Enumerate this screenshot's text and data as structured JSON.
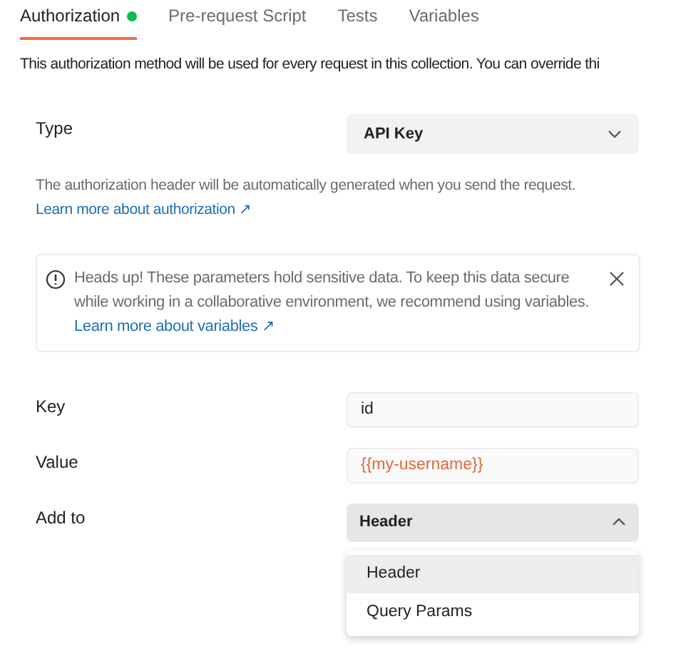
{
  "tabs": [
    {
      "label": "Authorization",
      "selected": true,
      "dot": true
    },
    {
      "label": "Pre-request Script",
      "selected": false,
      "dot": false
    },
    {
      "label": "Tests",
      "selected": false,
      "dot": false
    },
    {
      "label": "Variables",
      "selected": false,
      "dot": false
    }
  ],
  "description": "This authorization method will be used for every request in this collection. You can override thi",
  "type": {
    "label": "Type",
    "value": "API Key",
    "expanded": false
  },
  "hint": {
    "text": "The authorization header will be automatically generated when you send the request.",
    "link": "Learn more about authorization ↗"
  },
  "alert": {
    "text": "Heads up! These parameters hold sensitive data. To keep this data secure while working in a collaborative environment, we recommend using variables.",
    "link": "Learn more about variables ↗"
  },
  "fields": [
    {
      "label": "Key",
      "value": "id",
      "variable": false
    },
    {
      "label": "Value",
      "value": "{{my-username}}",
      "variable": true
    }
  ],
  "add_to": {
    "label": "Add to",
    "value": "Header",
    "expanded": true,
    "options": [
      {
        "label": "Header",
        "selected": true
      },
      {
        "label": "Query Params",
        "selected": false
      }
    ]
  }
}
